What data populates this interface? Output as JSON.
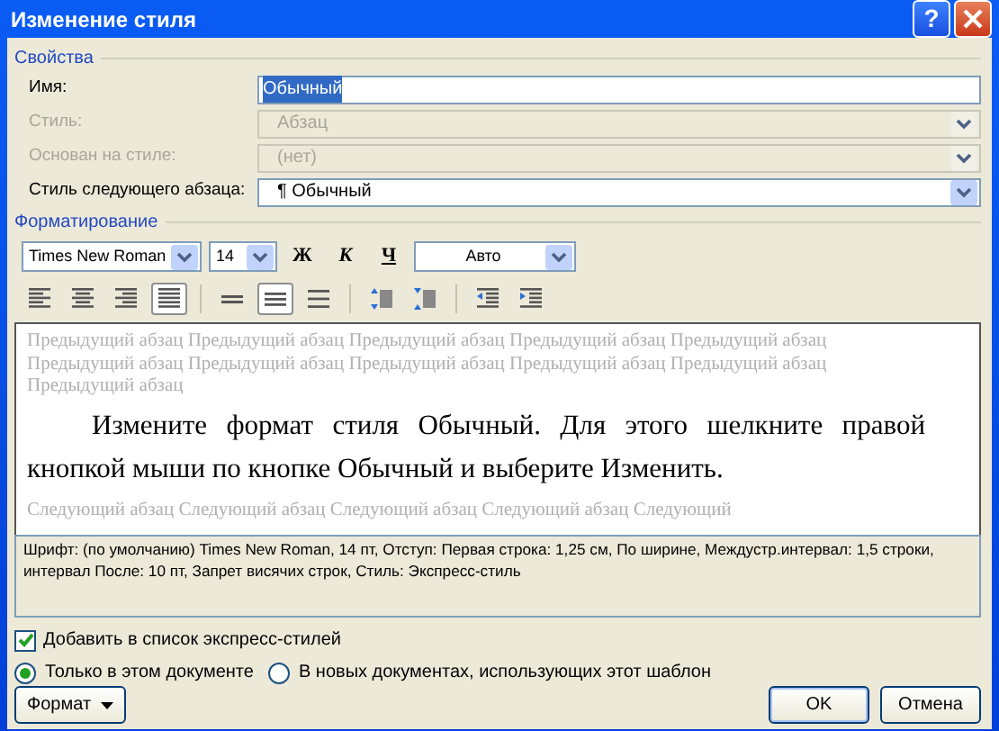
{
  "window": {
    "title": "Изменение стиля"
  },
  "title_buttons": [
    {
      "kind": "help",
      "label": "?"
    },
    {
      "kind": "close"
    }
  ],
  "properties": {
    "title": "Свойства",
    "fields": [
      {
        "label": "Имя:",
        "value": "Обычный",
        "kind": "text",
        "disabled": false,
        "highlighted": true
      },
      {
        "label": "Стиль:",
        "value": "Абзац",
        "kind": "dropdown",
        "disabled": true
      },
      {
        "label": "Основан на стиле:",
        "value": "(нет)",
        "kind": "dropdown",
        "disabled": true
      },
      {
        "label": "Стиль следующего абзаца:",
        "value": "Обычный",
        "prefix": "¶",
        "kind": "dropdown",
        "disabled": false
      }
    ]
  },
  "formatting": {
    "title": "Форматирование",
    "font": "Times New Roman",
    "size": "14",
    "color_label": "Авто",
    "style_buttons": [
      {
        "label": "Ж",
        "kind": "bold",
        "selected": false
      },
      {
        "label": "К",
        "kind": "italic",
        "selected": false
      },
      {
        "label": "Ч",
        "kind": "underline",
        "selected": false
      }
    ],
    "paragraph_buttons": [
      {
        "kind": "align-left",
        "selected": false
      },
      {
        "kind": "align-center",
        "selected": false
      },
      {
        "kind": "align-right",
        "selected": false
      },
      {
        "kind": "justify",
        "selected": true
      },
      {
        "kind": "separator"
      },
      {
        "kind": "single-spacing",
        "selected": false
      },
      {
        "kind": "one-half-spacing",
        "selected": true
      },
      {
        "kind": "double-spacing",
        "selected": false
      },
      {
        "kind": "separator"
      },
      {
        "kind": "space-before-up",
        "selected": false
      },
      {
        "kind": "space-before-down",
        "selected": false
      },
      {
        "kind": "separator"
      },
      {
        "kind": "indent-decrease",
        "selected": false
      },
      {
        "kind": "indent-increase",
        "selected": false
      }
    ]
  },
  "preview": {
    "previous": "Предыдущий абзац Предыдущий абзац Предыдущий абзац Предыдущий абзац Предыдущий абзац Предыдущий абзац Предыдущий абзац Предыдущий абзац Предыдущий абзац Предыдущий абзац Предыдущий абзац",
    "sample": "Измените формат стиля Обычный. Для этого шелкните правой кнопкой мыши по кнопке Обычный и выберите Изменить.",
    "next": "Следующий абзац Следующий абзац Следующий абзац Следующий абзац Следующий"
  },
  "description": "Шрифт: (по умолчанию) Times New Roman, 14 пт, Отступ: Первая строка:  1,25 см, По ширине, Междустр.интервал:  1,5 строки, интервал После:  10 пт, Запрет висячих строк, Стиль: Экспресс-стиль",
  "add_to_quick_styles": {
    "label": "Добавить в список экспресс-стилей",
    "checked": true
  },
  "scope": [
    {
      "label": "Только в этом документе",
      "selected": true
    },
    {
      "label": "В новых документах, использующих этот шаблон",
      "selected": false
    }
  ],
  "buttons": [
    {
      "label": "Формат",
      "kind": "menu"
    },
    {
      "label": "OK",
      "kind": "default"
    },
    {
      "label": "Отмена",
      "kind": "normal"
    }
  ]
}
